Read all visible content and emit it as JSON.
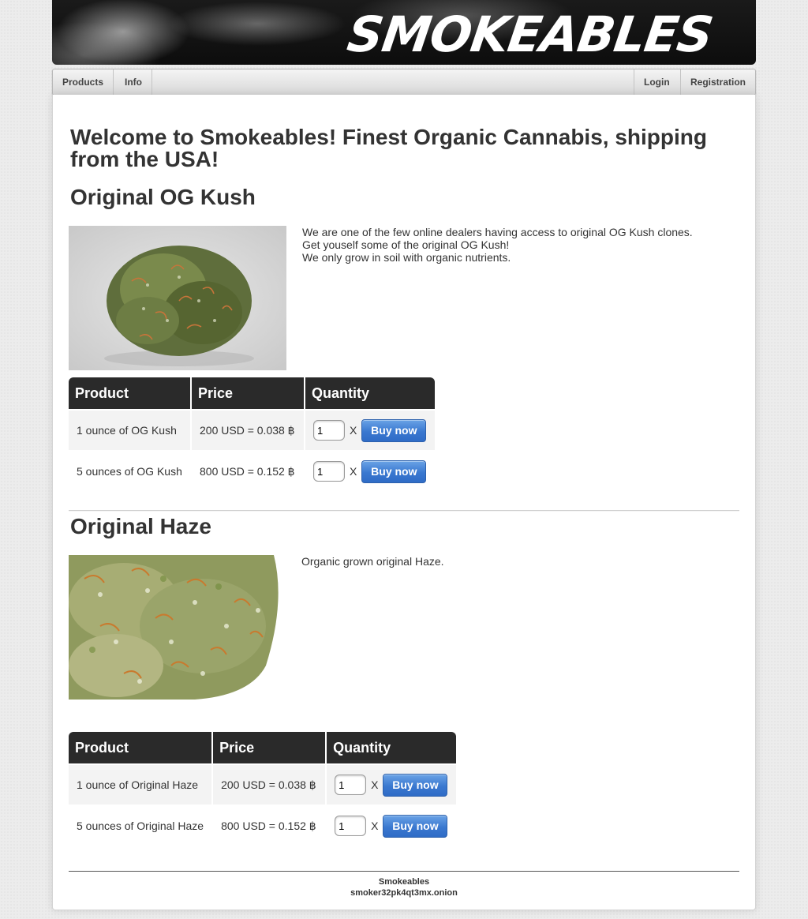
{
  "banner": {
    "logo_text": "SMOKEABLES"
  },
  "nav": {
    "left": [
      "Products",
      "Info"
    ],
    "right": [
      "Login",
      "Registration"
    ]
  },
  "welcome": "Welcome to Smokeables! Finest Organic Cannabis, shipping from the USA!",
  "products": [
    {
      "title": "Original OG Kush",
      "description": [
        "We are one of the few online dealers having access to original OG Kush clones.",
        "Get youself some of the original OG Kush!",
        "We only grow in soil with organic nutrients."
      ],
      "table": {
        "headers": [
          "Product",
          "Price",
          "Quantity"
        ],
        "rows": [
          {
            "product": "1 ounce of OG Kush",
            "price": "200 USD = 0.038 ฿",
            "qty": "1",
            "x": "X",
            "button": "Buy now"
          },
          {
            "product": "5 ounces of OG Kush",
            "price": "800 USD = 0.152 ฿",
            "qty": "1",
            "x": "X",
            "button": "Buy now"
          }
        ]
      }
    },
    {
      "title": "Original Haze",
      "description": [
        "Organic grown original Haze."
      ],
      "table": {
        "headers": [
          "Product",
          "Price",
          "Quantity"
        ],
        "rows": [
          {
            "product": "1 ounce of Original Haze",
            "price": "200 USD = 0.038 ฿",
            "qty": "1",
            "x": "X",
            "button": "Buy now"
          },
          {
            "product": "5 ounces of Original Haze",
            "price": "800 USD = 0.152 ฿",
            "qty": "1",
            "x": "X",
            "button": "Buy now"
          }
        ]
      }
    }
  ],
  "footer": {
    "name": "Smokeables",
    "address": "smoker32pk4qt3mx.onion"
  }
}
